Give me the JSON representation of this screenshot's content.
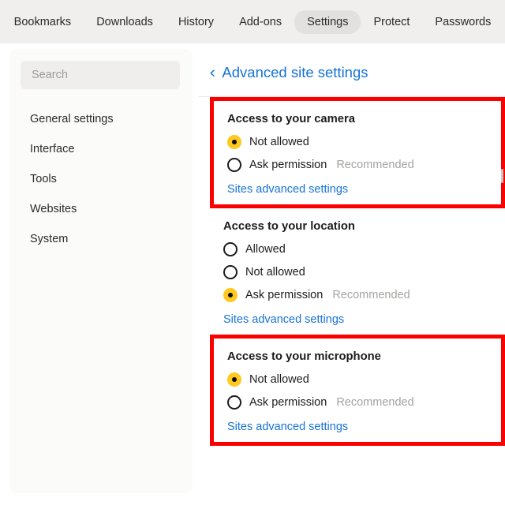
{
  "topnav": {
    "items": [
      {
        "label": "Bookmarks",
        "active": false
      },
      {
        "label": "Downloads",
        "active": false
      },
      {
        "label": "History",
        "active": false
      },
      {
        "label": "Add-ons",
        "active": false
      },
      {
        "label": "Settings",
        "active": true
      },
      {
        "label": "Protect",
        "active": false
      },
      {
        "label": "Passwords",
        "active": false
      }
    ]
  },
  "sidebar": {
    "search": {
      "value": "",
      "placeholder": "Search"
    },
    "items": [
      {
        "label": "General settings"
      },
      {
        "label": "Interface"
      },
      {
        "label": "Tools"
      },
      {
        "label": "Websites"
      },
      {
        "label": "System"
      }
    ]
  },
  "main": {
    "back_icon": "‹",
    "title": "Advanced site settings",
    "sections": [
      {
        "title": "Access to your camera",
        "highlighted": true,
        "options": [
          {
            "label": "Not allowed",
            "selected": true,
            "recommended": ""
          },
          {
            "label": "Ask permission",
            "selected": false,
            "recommended": "Recommended"
          }
        ],
        "link": "Sites advanced settings"
      },
      {
        "title": "Access to your location",
        "highlighted": false,
        "options": [
          {
            "label": "Allowed",
            "selected": false,
            "recommended": ""
          },
          {
            "label": "Not allowed",
            "selected": false,
            "recommended": ""
          },
          {
            "label": "Ask permission",
            "selected": true,
            "recommended": "Recommended"
          }
        ],
        "link": "Sites advanced settings"
      },
      {
        "title": "Access to your microphone",
        "highlighted": true,
        "options": [
          {
            "label": "Not allowed",
            "selected": true,
            "recommended": ""
          },
          {
            "label": "Ask permission",
            "selected": false,
            "recommended": "Recommended"
          }
        ],
        "link": "Sites advanced settings"
      }
    ]
  },
  "colors": {
    "accent_link": "#1573d6",
    "highlight_box": "#fc0000",
    "radio_selected": "#ffc91f",
    "nav_background": "#f0efed"
  }
}
